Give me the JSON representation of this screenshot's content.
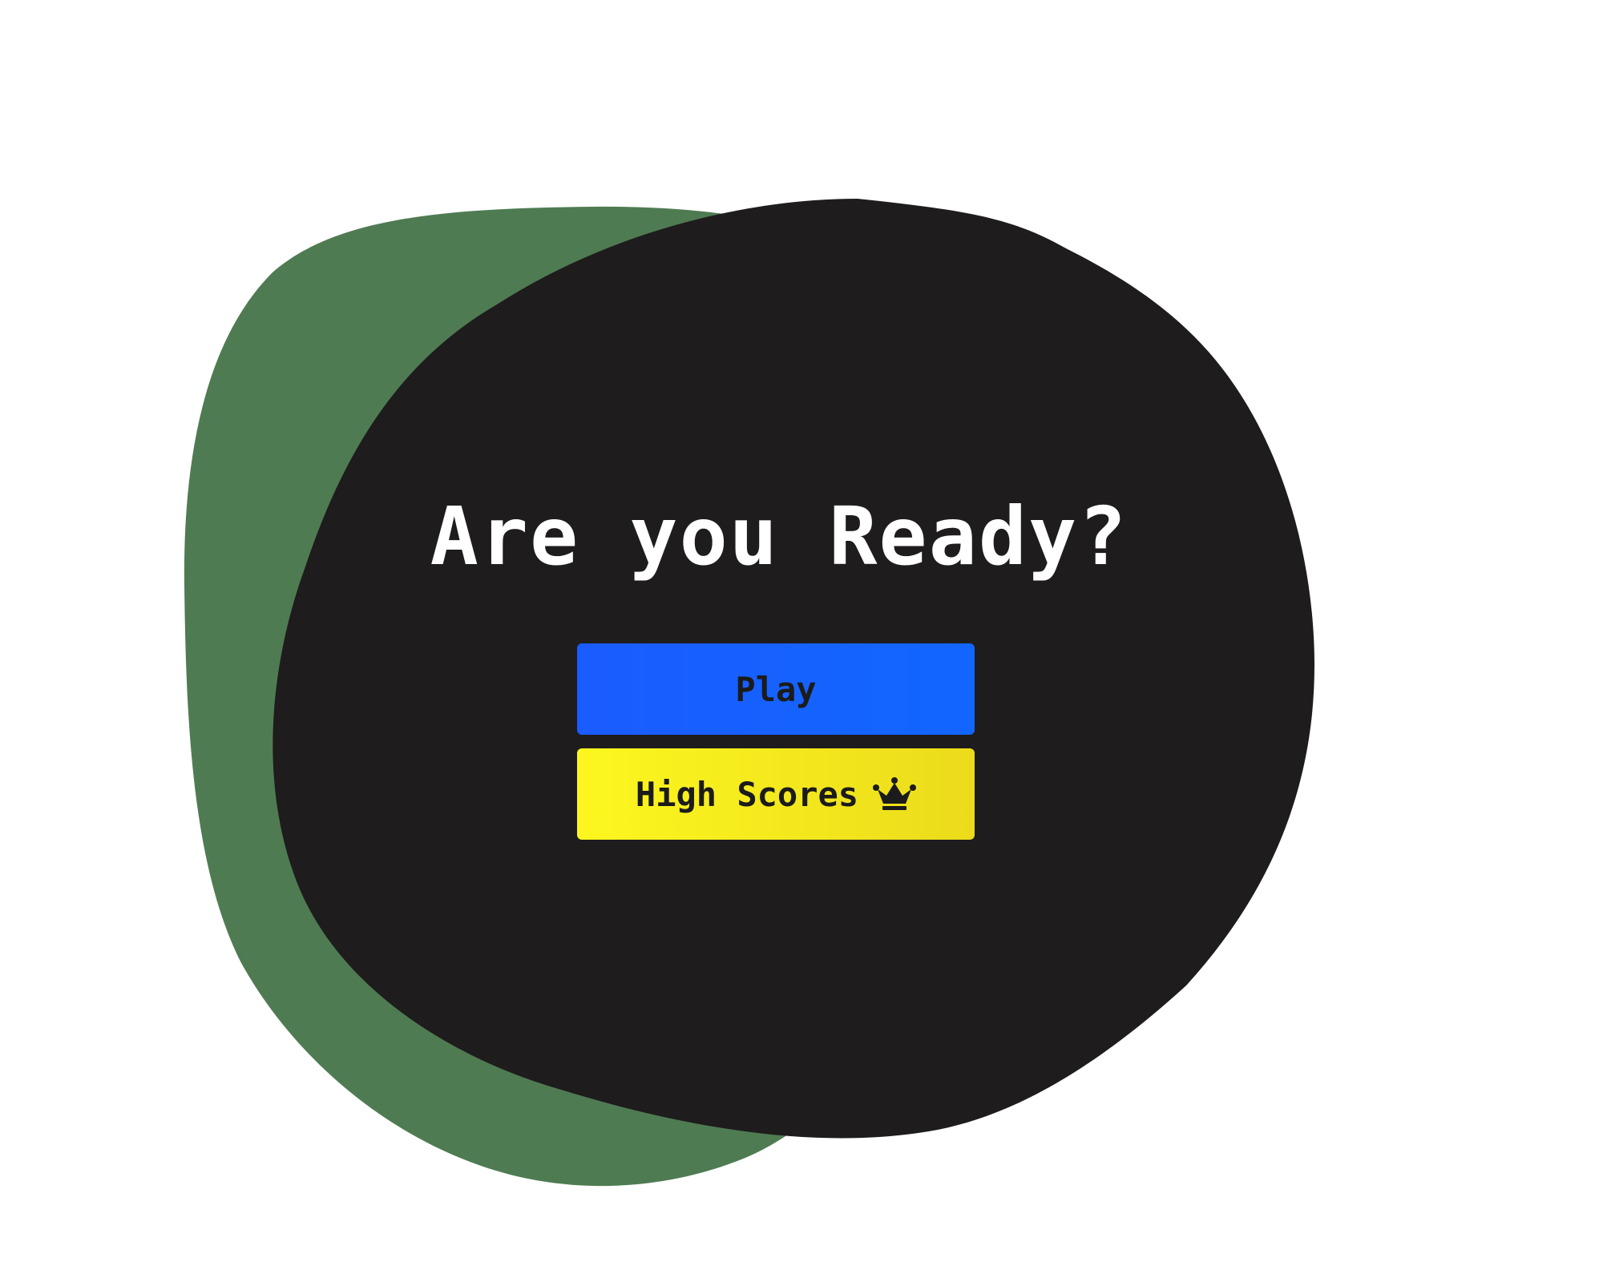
{
  "screen": {
    "title": "Are you Ready?"
  },
  "buttons": {
    "play": {
      "label": "Play"
    },
    "high_scores": {
      "label": "High Scores",
      "icon": "crown-icon"
    }
  },
  "colors": {
    "background": "#ffffff",
    "back_blob": "#4f7b52",
    "front_blob": "#1e1c1c",
    "play_start": "#1a5cff",
    "play_end": "#1266ff",
    "scores_start": "#fdf71f",
    "scores_end": "#ebdb1b",
    "button_text": "#1b1b1b",
    "title_text": "#ffffff"
  }
}
